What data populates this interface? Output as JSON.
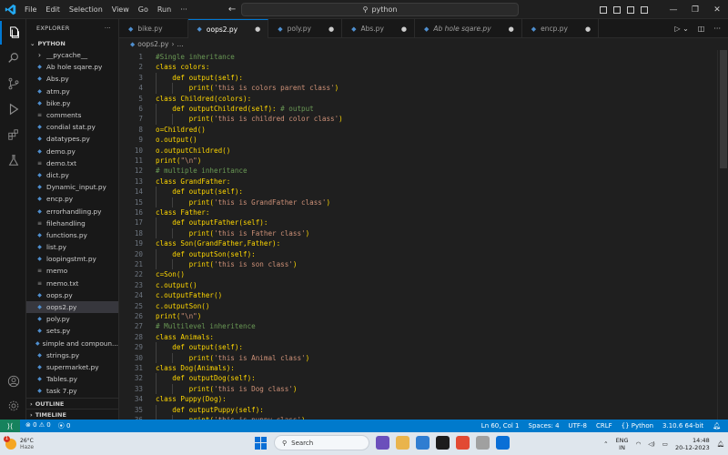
{
  "menu": [
    "File",
    "Edit",
    "Selection",
    "View",
    "Go",
    "Run",
    "···"
  ],
  "search_box": "python",
  "explorer": {
    "title": "EXPLORER",
    "folder": "PYTHON",
    "files": [
      {
        "name": "__pycache__",
        "icon": "chevron-right"
      },
      {
        "name": "Ab hole sqare.py",
        "icon": "python"
      },
      {
        "name": "Abs.py",
        "icon": "python"
      },
      {
        "name": "atm.py",
        "icon": "python"
      },
      {
        "name": "bike.py",
        "icon": "python"
      },
      {
        "name": "comments",
        "icon": "file"
      },
      {
        "name": "condial stat.py",
        "icon": "python"
      },
      {
        "name": "datatypes.py",
        "icon": "python"
      },
      {
        "name": "demo.py",
        "icon": "python"
      },
      {
        "name": "demo.txt",
        "icon": "file"
      },
      {
        "name": "dict.py",
        "icon": "python"
      },
      {
        "name": "Dynamic_input.py",
        "icon": "python"
      },
      {
        "name": "encp.py",
        "icon": "python"
      },
      {
        "name": "errorhandling.py",
        "icon": "python"
      },
      {
        "name": "filehandling",
        "icon": "file"
      },
      {
        "name": "functions.py",
        "icon": "python"
      },
      {
        "name": "list.py",
        "icon": "python"
      },
      {
        "name": "loopingstmt.py",
        "icon": "python"
      },
      {
        "name": "memo",
        "icon": "file"
      },
      {
        "name": "memo.txt",
        "icon": "file"
      },
      {
        "name": "oops.py",
        "icon": "python"
      },
      {
        "name": "oops2.py",
        "icon": "python",
        "selected": true
      },
      {
        "name": "poly.py",
        "icon": "python"
      },
      {
        "name": "sets.py",
        "icon": "python"
      },
      {
        "name": "simple and compoun...",
        "icon": "python"
      },
      {
        "name": "strings.py",
        "icon": "python"
      },
      {
        "name": "supermarket.py",
        "icon": "python"
      },
      {
        "name": "Tables.py",
        "icon": "python"
      },
      {
        "name": "task 7.py",
        "icon": "python"
      }
    ],
    "outline": "OUTLINE",
    "timeline": "TIMELINE"
  },
  "tabs": [
    {
      "label": "bike.py",
      "active": false,
      "italic": false,
      "marker": ""
    },
    {
      "label": "oops2.py",
      "active": true,
      "italic": false,
      "marker": "●"
    },
    {
      "label": "poly.py",
      "active": false,
      "italic": false,
      "marker": "●"
    },
    {
      "label": "Abs.py",
      "active": false,
      "italic": false,
      "marker": "●"
    },
    {
      "label": "Ab hole sqare.py",
      "active": false,
      "italic": true,
      "marker": "●"
    },
    {
      "label": "encp.py",
      "active": false,
      "italic": false,
      "marker": "●"
    }
  ],
  "breadcrumb": [
    "oops2.py",
    "..."
  ],
  "code_lines": [
    {
      "n": "1",
      "text": "#Single inheritance",
      "kind": "comment",
      "indent": 0
    },
    {
      "n": "2",
      "text": "class colors:",
      "kind": "code",
      "indent": 0
    },
    {
      "n": "3",
      "text": "    def output(self):",
      "kind": "code",
      "indent": 1
    },
    {
      "n": "4",
      "text": "        print('this is colors parent class')",
      "kind": "code",
      "indent": 2
    },
    {
      "n": "5",
      "text": "class Childred(colors):",
      "kind": "code",
      "indent": 0
    },
    {
      "n": "6",
      "text": "    def outputChildred(self): # output",
      "kind": "code",
      "indent": 1
    },
    {
      "n": "7",
      "text": "        print('this is childred color class')",
      "kind": "code",
      "indent": 2
    },
    {
      "n": "8",
      "text": "o=Childred()",
      "kind": "code",
      "indent": 0
    },
    {
      "n": "9",
      "text": "o.output()",
      "kind": "code",
      "indent": 0
    },
    {
      "n": "10",
      "text": "o.outputChildred()",
      "kind": "code",
      "indent": 0
    },
    {
      "n": "11",
      "text": "print(\"\\n\")",
      "kind": "code",
      "indent": 0
    },
    {
      "n": "12",
      "text": "# multiple inheritance",
      "kind": "comment",
      "indent": 0
    },
    {
      "n": "13",
      "text": "class GrandFather:",
      "kind": "code",
      "indent": 0
    },
    {
      "n": "14",
      "text": "    def output(self):",
      "kind": "code",
      "indent": 1
    },
    {
      "n": "15",
      "text": "        print('this is GrandFather class')",
      "kind": "code",
      "indent": 2
    },
    {
      "n": "16",
      "text": "class Father:",
      "kind": "code",
      "indent": 0
    },
    {
      "n": "17",
      "text": "    def outputFather(self):",
      "kind": "code",
      "indent": 1
    },
    {
      "n": "18",
      "text": "        print('this is Father class')",
      "kind": "code",
      "indent": 2
    },
    {
      "n": "19",
      "text": "class Son(GrandFather,Father):",
      "kind": "code",
      "indent": 0
    },
    {
      "n": "20",
      "text": "    def outputSon(self):",
      "kind": "code",
      "indent": 1
    },
    {
      "n": "21",
      "text": "        print('this is son class')",
      "kind": "code",
      "indent": 2
    },
    {
      "n": "22",
      "text": "c=Son()",
      "kind": "code",
      "indent": 0
    },
    {
      "n": "23",
      "text": "c.output()",
      "kind": "code",
      "indent": 0
    },
    {
      "n": "24",
      "text": "c.outputFather()",
      "kind": "code",
      "indent": 0
    },
    {
      "n": "25",
      "text": "c.outputSon()",
      "kind": "code",
      "indent": 0
    },
    {
      "n": "26",
      "text": "print(\"\\n\")",
      "kind": "code",
      "indent": 0
    },
    {
      "n": "27",
      "text": "# Multilevel inheritence",
      "kind": "comment",
      "indent": 0
    },
    {
      "n": "28",
      "text": "class Animals:",
      "kind": "code",
      "indent": 0
    },
    {
      "n": "29",
      "text": "    def output(self):",
      "kind": "code",
      "indent": 1
    },
    {
      "n": "30",
      "text": "        print('this is Animal class')",
      "kind": "code",
      "indent": 2
    },
    {
      "n": "31",
      "text": "class Dog(Animals):",
      "kind": "code",
      "indent": 0
    },
    {
      "n": "32",
      "text": "    def outputDog(self):",
      "kind": "code",
      "indent": 1
    },
    {
      "n": "33",
      "text": "        print('this is Dog class')",
      "kind": "code",
      "indent": 2
    },
    {
      "n": "34",
      "text": "class Puppy(Dog):",
      "kind": "code",
      "indent": 0
    },
    {
      "n": "35",
      "text": "    def outputPuppy(self):",
      "kind": "code",
      "indent": 1
    },
    {
      "n": "36",
      "text": "        print('this is puppy class')",
      "kind": "code",
      "indent": 2
    }
  ],
  "statusbar": {
    "errors": "⊗ 0 ⚠ 0",
    "ports": "⦿ 0",
    "position": "Ln 60, Col 1",
    "spaces": "Spaces: 4",
    "encoding": "UTF-8",
    "eol": "CRLF",
    "language": "Python",
    "interpreter": "3.10.6 64-bit"
  },
  "taskbar": {
    "temperature": "26°C",
    "weather": "Haze",
    "badge": "1",
    "search": "Search",
    "lang_1": "ENG",
    "lang_2": "IN",
    "time": "14:48",
    "date": "20-12-2023"
  },
  "colors": {
    "accent": "#007acc",
    "editor_bg": "#1f1f1f",
    "code_text": "#ffd700",
    "comment": "#6a9955",
    "string": "#ce9178"
  }
}
